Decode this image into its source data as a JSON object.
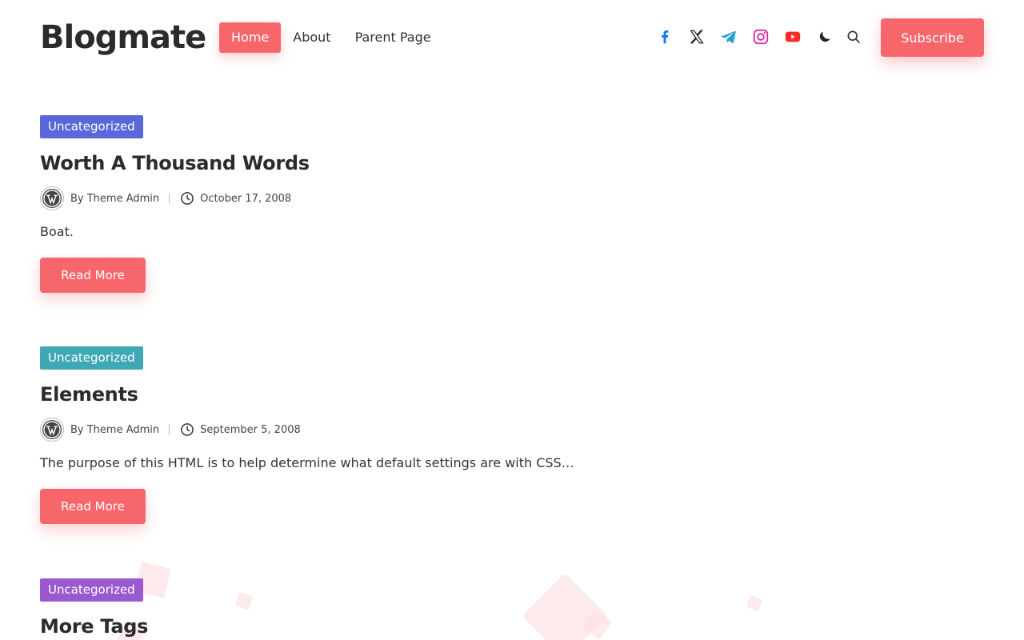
{
  "site": {
    "title": "Blogmate"
  },
  "nav": {
    "items": [
      {
        "label": "Home"
      },
      {
        "label": "About"
      },
      {
        "label": "Parent Page"
      }
    ]
  },
  "header": {
    "social_icons": [
      "facebook-icon",
      "x-icon",
      "telegram-icon",
      "instagram-icon",
      "youtube-icon"
    ],
    "subscribe_label": "Subscribe",
    "accent_color": "#f7666b"
  },
  "posts": [
    {
      "category": "Uncategorized",
      "category_color": "#5a67d8",
      "title": "Worth A Thousand Words",
      "author": "By Theme Admin",
      "date": "October 17, 2008",
      "excerpt": "Boat.",
      "read_more": "Read More"
    },
    {
      "category": "Uncategorized",
      "category_color": "#3ea8b5",
      "title": "Elements",
      "author": "By Theme Admin",
      "date": "September 5, 2008",
      "excerpt": "The purpose of this HTML is to help determine what default settings are with CSS…",
      "read_more": "Read More"
    },
    {
      "category": "Uncategorized",
      "category_color": "#9b59d0",
      "title": "More Tags"
    }
  ]
}
